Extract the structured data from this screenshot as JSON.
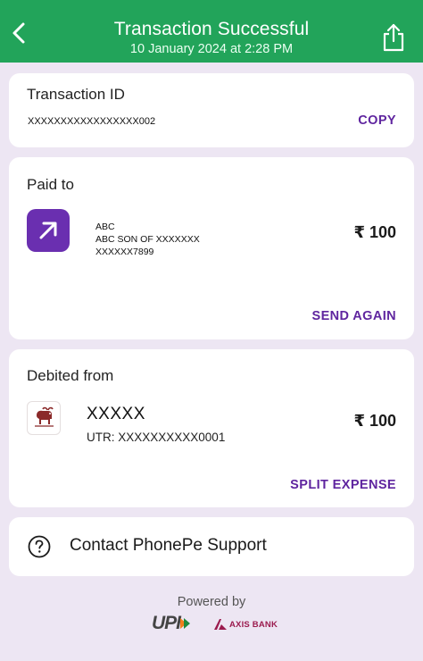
{
  "header": {
    "title": "Transaction Successful",
    "subtitle": "10 January 2024 at 2:28 PM",
    "back_icon": "chevron-left-icon",
    "share_icon": "share-icon"
  },
  "transaction": {
    "label": "Transaction ID",
    "id": "XXXXXXXXXXXXXXXXX002",
    "copy_label": "COPY"
  },
  "paid_to": {
    "label": "Paid to",
    "icon": "arrow-up-right-icon",
    "name": "ABC",
    "detail": "ABC SON OF XXXXXXX",
    "account": "XXXXXX7899",
    "amount": "₹ 100",
    "action_label": "SEND AGAIN"
  },
  "debited_from": {
    "label": "Debited from",
    "bank_icon": "bank-logo-icon",
    "account": "XXXXX",
    "utr": "UTR: XXXXXXXXXX0001",
    "amount": "₹ 100",
    "action_label": "SPLIT EXPENSE"
  },
  "support": {
    "icon": "help-circle-icon",
    "label": "Contact PhonePe Support"
  },
  "footer": {
    "powered_by": "Powered by",
    "upi_label": "UPI",
    "bank_label": "AXIS BANK"
  },
  "colors": {
    "header_green": "#22a45a",
    "brand_purple": "#5f259f",
    "background": "#ede6f3"
  }
}
